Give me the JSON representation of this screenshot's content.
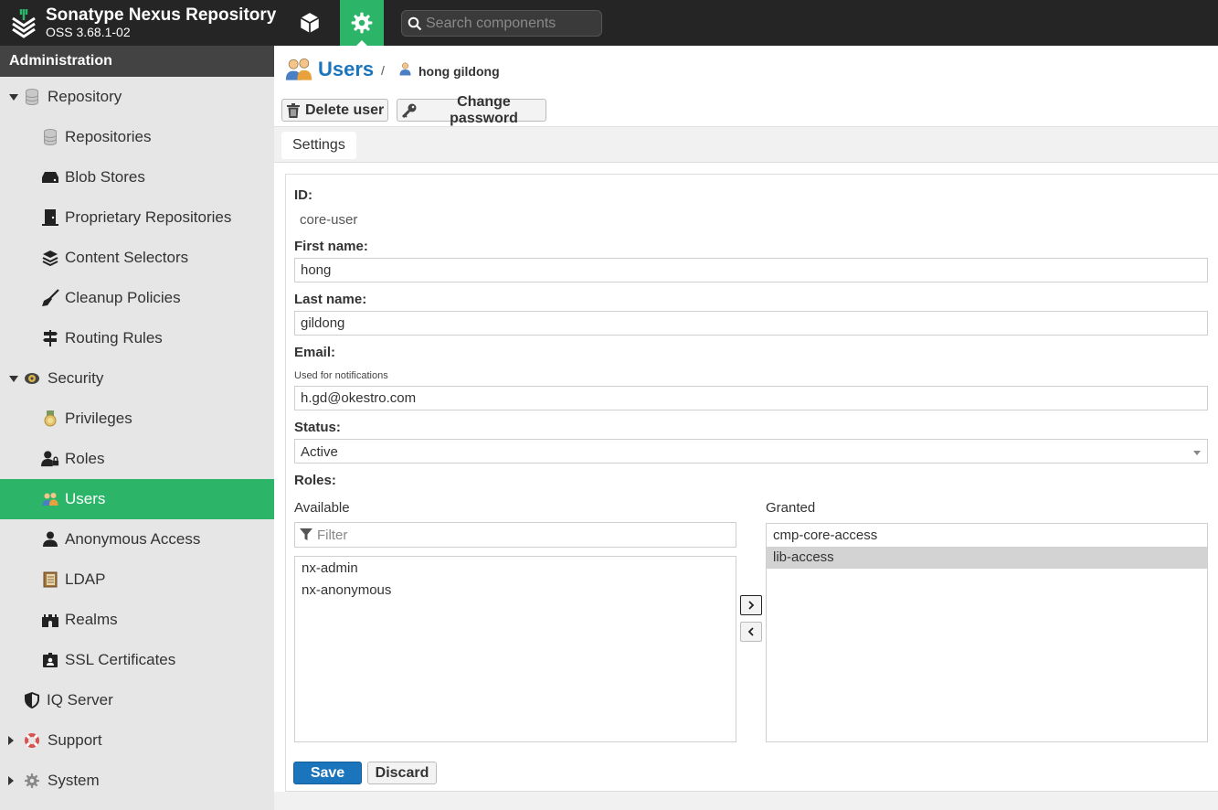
{
  "header": {
    "title": "Sonatype Nexus Repository",
    "version": "OSS 3.68.1-02",
    "search_placeholder": "Search components"
  },
  "sidebar": {
    "title": "Administration",
    "items": [
      {
        "label": "Repository",
        "icon": "database-icon"
      },
      {
        "label": "Repositories",
        "icon": "database-icon"
      },
      {
        "label": "Blob Stores",
        "icon": "hdd-icon"
      },
      {
        "label": "Proprietary Repositories",
        "icon": "door-icon"
      },
      {
        "label": "Content Selectors",
        "icon": "layers-icon"
      },
      {
        "label": "Cleanup Policies",
        "icon": "broom-icon"
      },
      {
        "label": "Routing Rules",
        "icon": "signpost-icon"
      },
      {
        "label": "Security",
        "icon": "security-badge-icon"
      },
      {
        "label": "Privileges",
        "icon": "medal-icon"
      },
      {
        "label": "Roles",
        "icon": "user-lock-icon"
      },
      {
        "label": "Users",
        "icon": "users-icon"
      },
      {
        "label": "Anonymous Access",
        "icon": "user-icon"
      },
      {
        "label": "LDAP",
        "icon": "book-icon"
      },
      {
        "label": "Realms",
        "icon": "castle-icon"
      },
      {
        "label": "SSL Certificates",
        "icon": "id-badge-icon"
      },
      {
        "label": "IQ Server",
        "icon": "shield-icon"
      },
      {
        "label": "Support",
        "icon": "lifebuoy-icon"
      },
      {
        "label": "System",
        "icon": "gear-icon"
      }
    ]
  },
  "breadcrumb": {
    "title": "Users",
    "separator": "/",
    "current": "hong gildong"
  },
  "toolbar": {
    "delete_label": "Delete user",
    "change_password_label": "Change password"
  },
  "tabs": {
    "settings": "Settings"
  },
  "form": {
    "id_label": "ID:",
    "id_value": "core-user",
    "first_name_label": "First name:",
    "first_name_value": "hong",
    "last_name_label": "Last name:",
    "last_name_value": "gildong",
    "email_label": "Email:",
    "email_help": "Used for notifications",
    "email_value": "h.gd@okestro.com",
    "status_label": "Status:",
    "status_value": "Active",
    "roles_label": "Roles:",
    "available_label": "Available",
    "granted_label": "Granted",
    "filter_placeholder": "Filter",
    "available_roles": [
      "nx-admin",
      "nx-anonymous"
    ],
    "granted_roles": [
      "cmp-core-access",
      "lib-access"
    ],
    "save_label": "Save",
    "discard_label": "Discard"
  },
  "colors": {
    "accent_green": "#2cb569",
    "link_blue": "#1b75bc",
    "header_bg": "#252525"
  }
}
